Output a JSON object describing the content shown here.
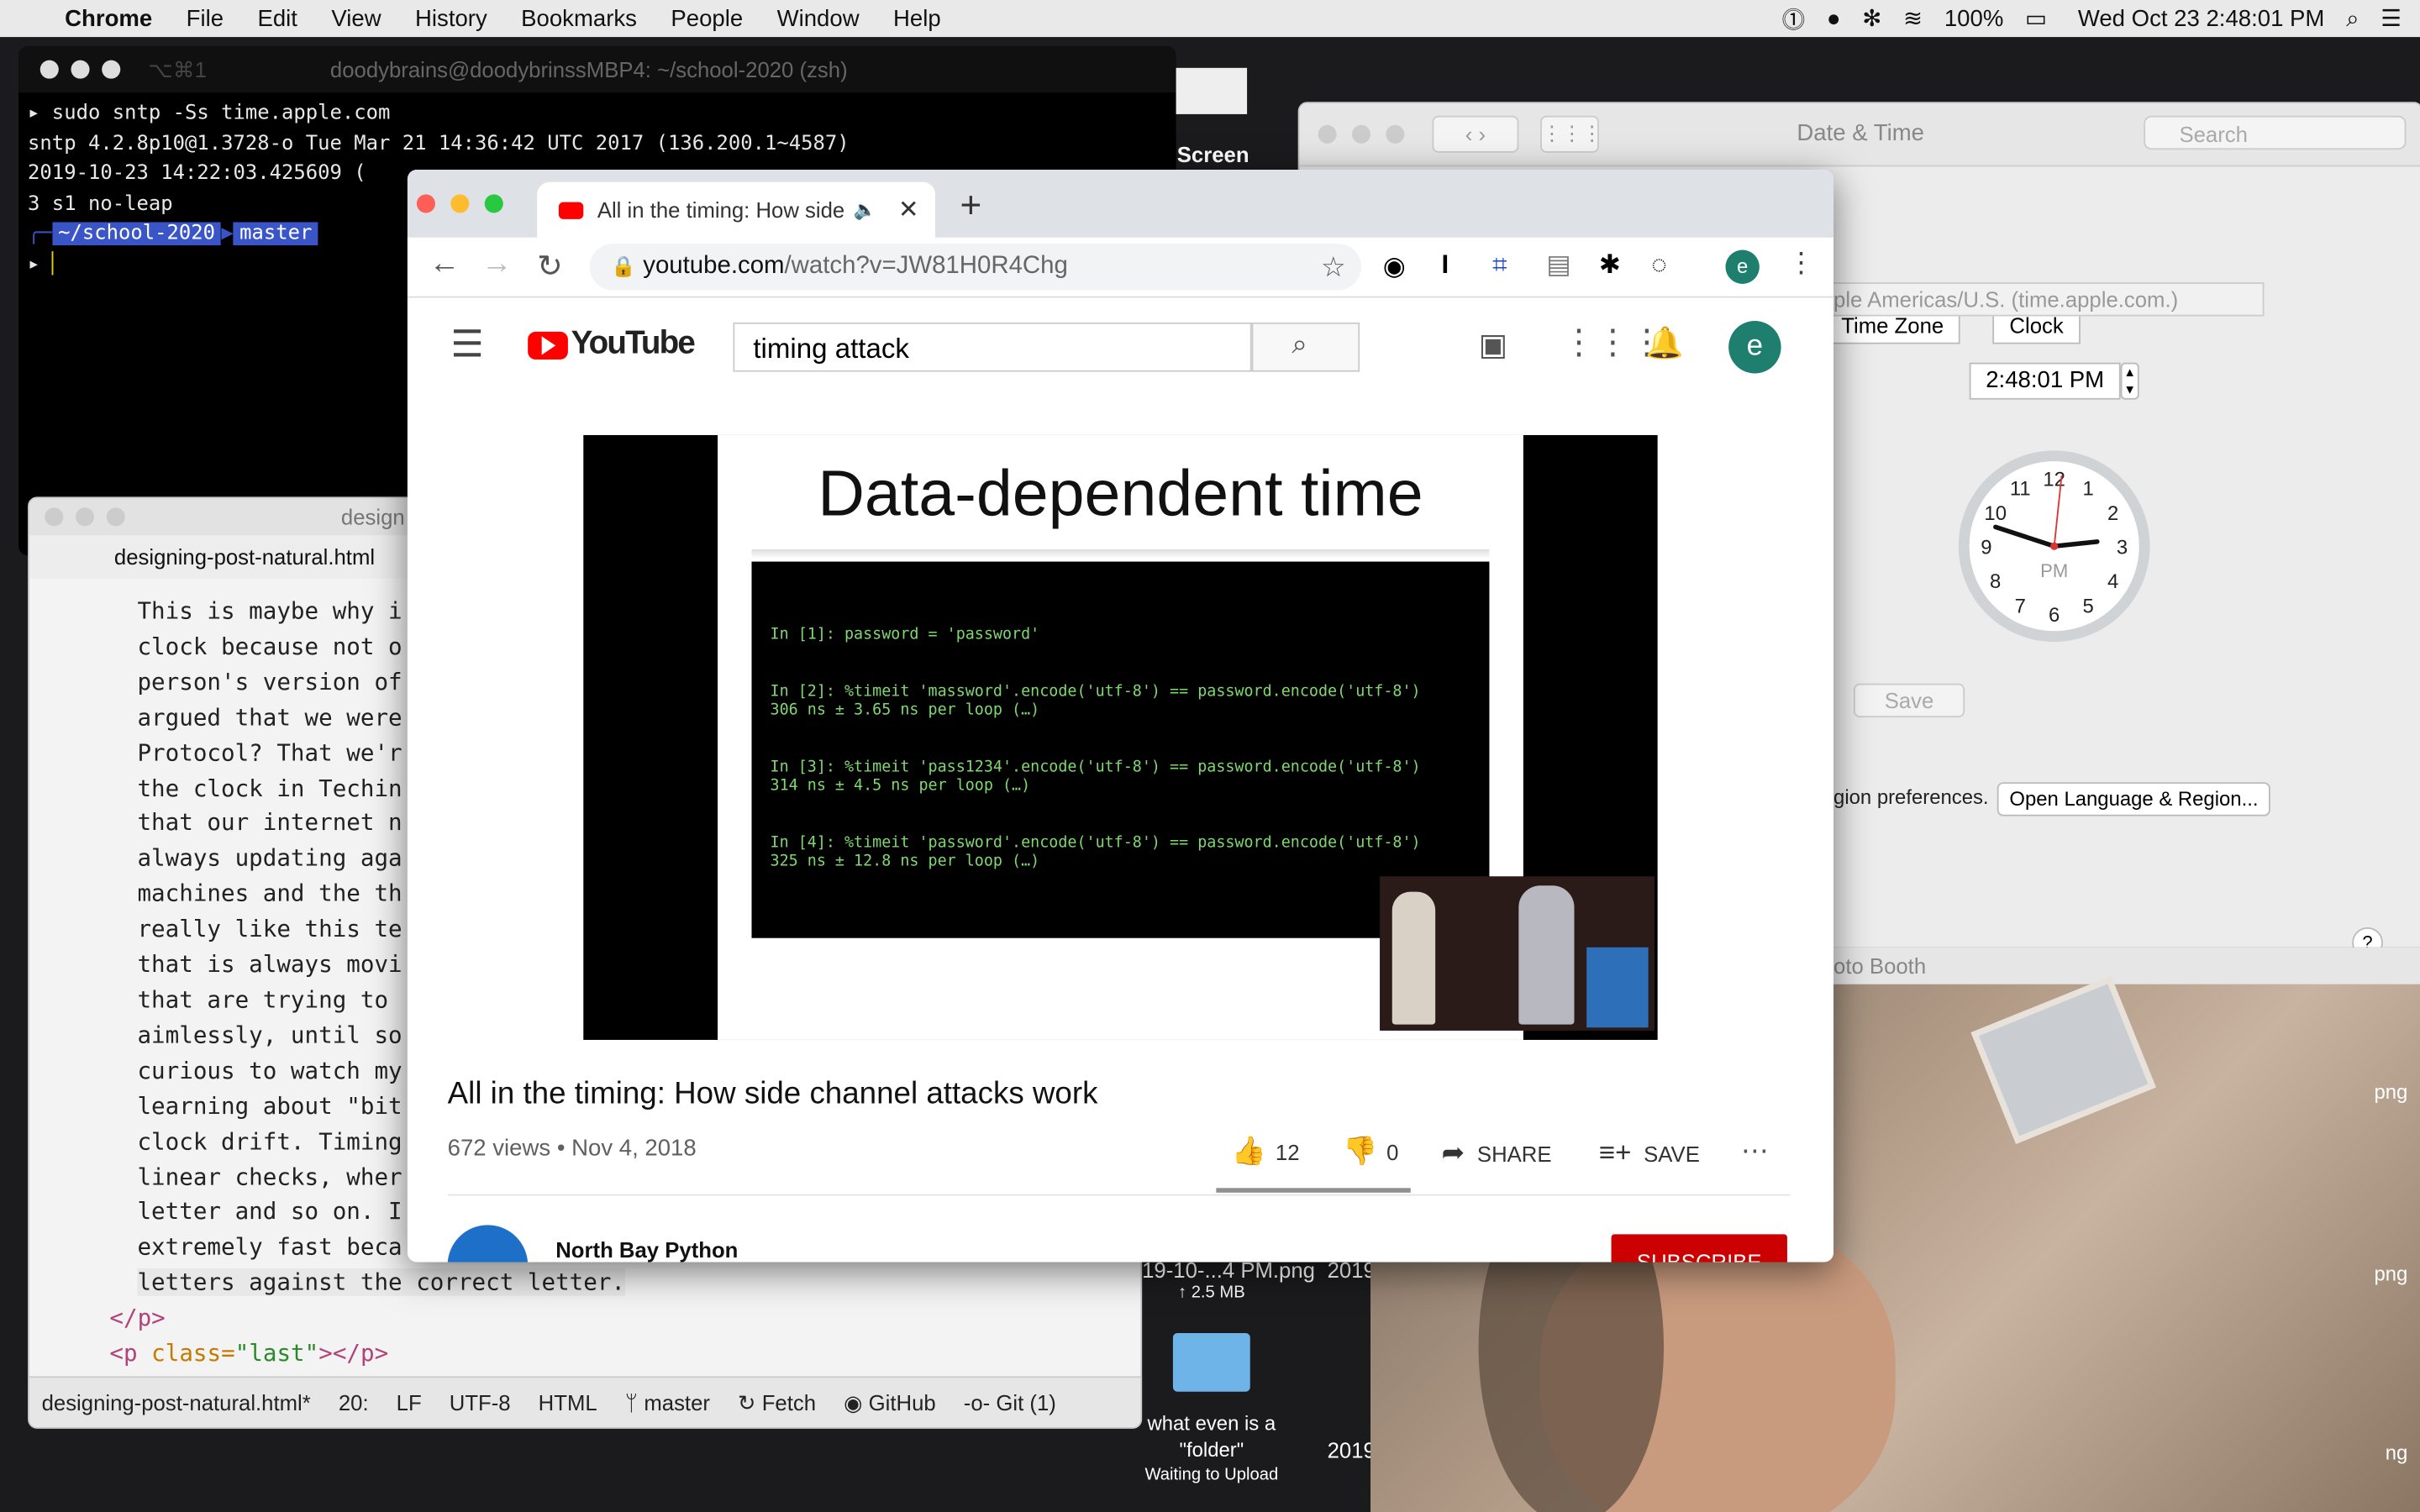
{
  "menubar": {
    "app": "Chrome",
    "items": [
      "File",
      "Edit",
      "View",
      "History",
      "Bookmarks",
      "People",
      "Window",
      "Help"
    ],
    "battery": "100%",
    "datetime": "Wed Oct 23  2:48:01 PM"
  },
  "terminal": {
    "shortcut": "⌥⌘1",
    "title": "doodybrains@doodybrinssMBP4: ~/school-2020 (zsh)",
    "lines": [
      "▸ sudo sntp -Ss time.apple.com",
      "sntp 4.2.8p10@1.3728-o Tue Mar 21 14:36:42 UTC 2017 (136.200.1~4587)",
      "2019-10-23 14:22:03.425609 (",
      "3 s1 no-leap"
    ],
    "prompt_dir": "~/school-2020",
    "prompt_branch": "master"
  },
  "editor": {
    "title": "design",
    "tab": "designing-post-natural.html",
    "lines": [
      "This is maybe why i",
      "clock because not o",
      "person's version of",
      "argued that we were",
      "Protocol? That we'r",
      "the clock in Techin",
      "that our internet n",
      "always updating aga",
      "machines and the th",
      "really like this te",
      "that is always movi",
      "that are trying to",
      "aimlessly, until so",
      "curious to watch my",
      "learning about \"bit",
      "clock drift. Timing",
      "linear checks, wher",
      "letter and so on. I",
      "extremely fast beca",
      "letters against the correct letter."
    ],
    "close_p": "</p>",
    "last_p_open": "<p ",
    "last_p_attr": "class=",
    "last_p_val": "\"last\"",
    "last_p_close": "></p>",
    "status": {
      "file": "designing-post-natural.html*",
      "pos": "20:",
      "eol": "LF",
      "enc": "UTF-8",
      "lang": "HTML",
      "branch": "master",
      "fetch": "Fetch",
      "github": "GitHub",
      "git": "Git (1)"
    }
  },
  "datetime_prefs": {
    "title": "Date & Time",
    "search_placeholder": "Search",
    "tabs": [
      "Time Zone",
      "Clock"
    ],
    "server": "ple Americas/U.S. (time.apple.com.)",
    "time": "2:48:01 PM",
    "clock_label": "PM",
    "save": "Save",
    "region_text": "gion preferences.",
    "region_button": "Open Language & Region...",
    "help": "?",
    "hour": 2,
    "minute": 48,
    "second": 1
  },
  "photo_booth": {
    "title": "oto Booth"
  },
  "desktop": {
    "screenshot_label": "Screen Shot",
    "file_label": "19-10-...4 PM.png",
    "file_year": "2019",
    "upload": "↑ 2.5 MB",
    "folder_name": "what even is a \"folder\"",
    "folder_status": "Waiting to Upload",
    "year2": "2019",
    "right_labels": [
      "png",
      "png",
      "ng"
    ]
  },
  "chrome": {
    "tab_title": "All in the timing: How side c",
    "url_host": "youtube.com",
    "url_path": "/watch?v=JW81H0R4Chg",
    "profile_initial": "e"
  },
  "youtube": {
    "logo": "YouTube",
    "search_value": "timing attack",
    "avatar": "e",
    "slide_title": "Data-dependent time",
    "code": [
      "In [1]: password = 'password'",
      "In [2]: %timeit 'massword'.encode('utf-8') == password.encode('utf-8')\n306 ns ± 3.65 ns per loop (…)",
      "In [3]: %timeit 'pass1234'.encode('utf-8') == password.encode('utf-8')\n314 ns ± 4.5 ns per loop (…)",
      "In [4]: %timeit 'password'.encode('utf-8') == password.encode('utf-8')\n325 ns ± 12.8 ns per loop (…)"
    ],
    "video_title": "All in the timing: How side channel attacks work",
    "views": "672 views • Nov 4, 2018",
    "likes": "12",
    "dislikes": "0",
    "share": "SHARE",
    "save": "SAVE",
    "channel": "North Bay Python",
    "subscribe": "SUBSCRIBE"
  }
}
